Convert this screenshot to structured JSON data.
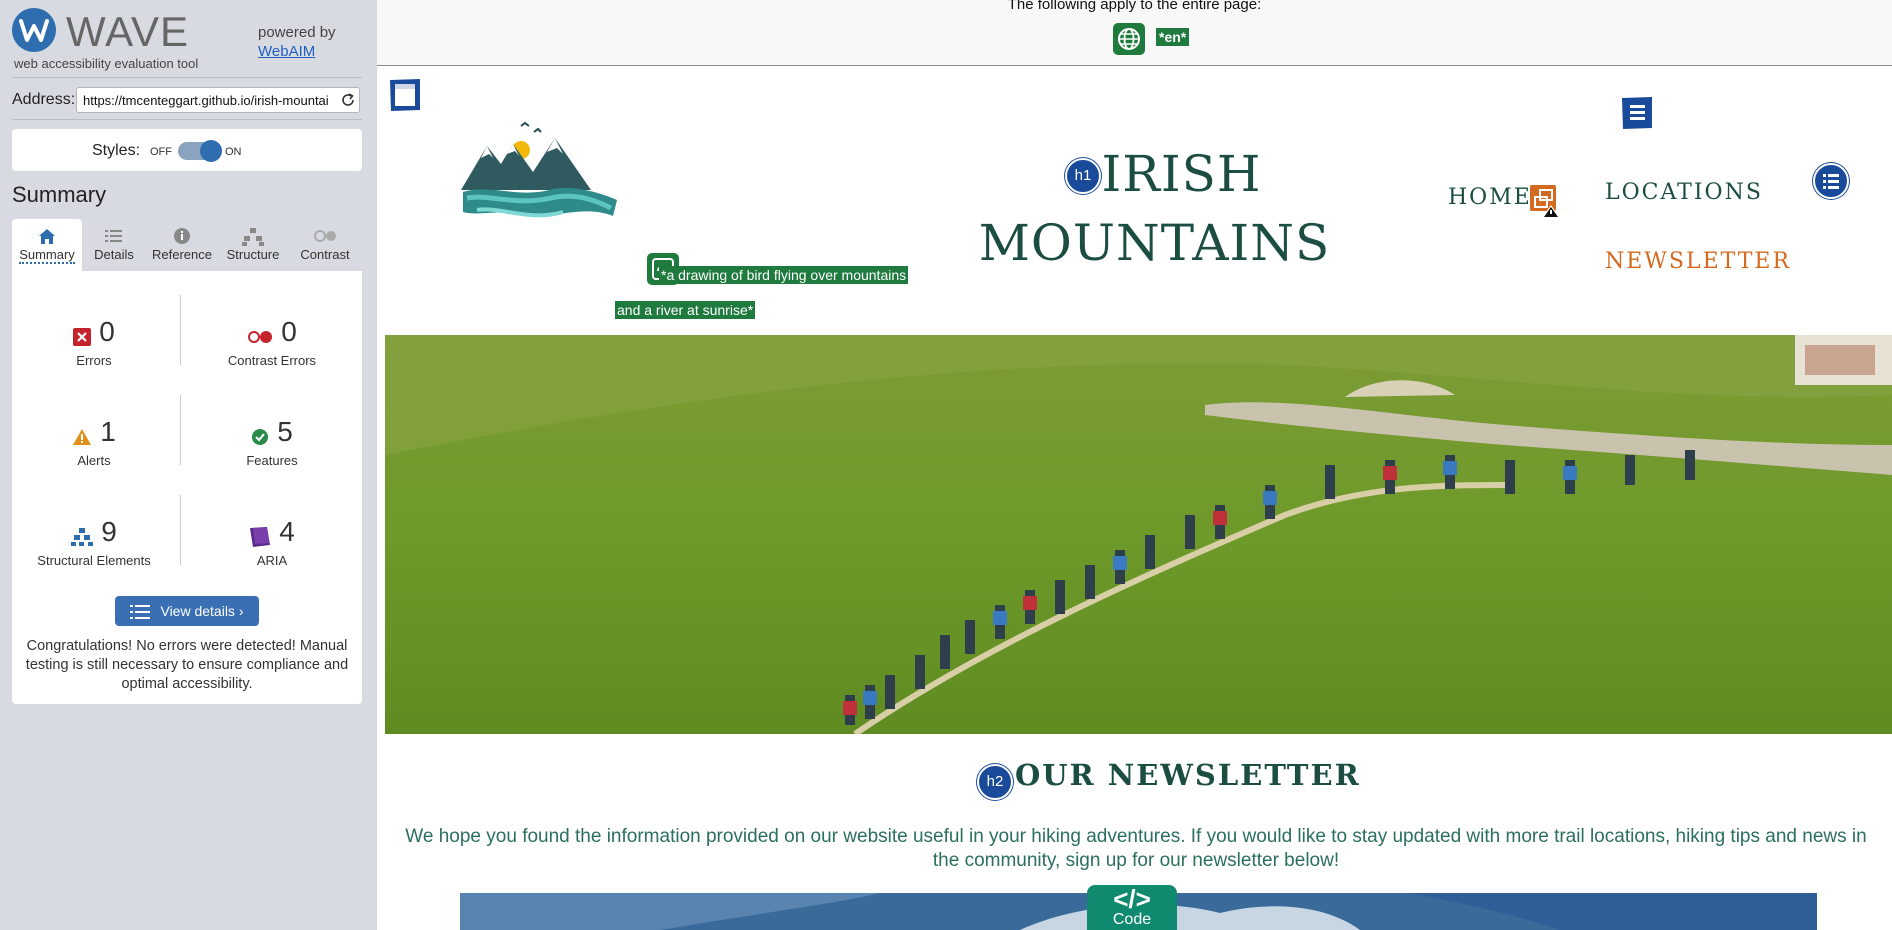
{
  "wave": {
    "brand": "WAVE",
    "tagline": "web accessibility evaluation tool",
    "powered_by": "powered by",
    "webaim": "WebAIM",
    "address_label": "Address:",
    "address_value": "https://tmcenteggart.github.io/irish-mountai",
    "styles_label": "Styles:",
    "styles_off": "OFF",
    "styles_on": "ON",
    "summary_title": "Summary",
    "tabs": [
      {
        "label": "Summary",
        "icon": "home-icon",
        "active": true
      },
      {
        "label": "Details",
        "icon": "list-icon"
      },
      {
        "label": "Reference",
        "icon": "info-icon"
      },
      {
        "label": "Structure",
        "icon": "structure-icon"
      },
      {
        "label": "Contrast",
        "icon": "contrast-icon"
      }
    ],
    "stats": {
      "errors": {
        "count": "0",
        "label": "Errors"
      },
      "contrast_errors": {
        "count": "0",
        "label": "Contrast Errors"
      },
      "alerts": {
        "count": "1",
        "label": "Alerts"
      },
      "features": {
        "count": "5",
        "label": "Features"
      },
      "structural": {
        "count": "9",
        "label": "Structural Elements"
      },
      "aria": {
        "count": "4",
        "label": "ARIA"
      }
    },
    "view_details": "View details ›",
    "congrats": "Congratulations! No errors were detected! Manual testing is still necessary to ensure compliance and optimal accessibility."
  },
  "page": {
    "doc_note": "The following apply to the entire page:",
    "lang_tag": "*en*",
    "logo_alt_line1": "*a drawing of bird flying over mountains",
    "logo_alt_line2": "and a river at sunrise*",
    "h1_badge": "h1",
    "title_line1": "IRISH",
    "title_line2": "MOUNTAINS",
    "nav": {
      "home": "HOME",
      "locations": "LOCATIONS",
      "newsletter": "NEWSLETTER"
    },
    "h2_badge": "h2",
    "newsletter_title": "OUR NEWSLETTER",
    "newsletter_text": "We hope you found the information provided on our website useful in your hiking adventures. If you would like to stay updated with more trail locations, hiking tips and news in the community, sign up for our newsletter below!",
    "code_tab": "Code",
    "code_symbol": "</>"
  },
  "colors": {
    "wave_blue": "#2d6db0",
    "feature_green": "#1f7a3e",
    "structure_blue": "#1a4a9a",
    "title_green": "#1b4d43",
    "nav_orange": "#d36a1f"
  }
}
